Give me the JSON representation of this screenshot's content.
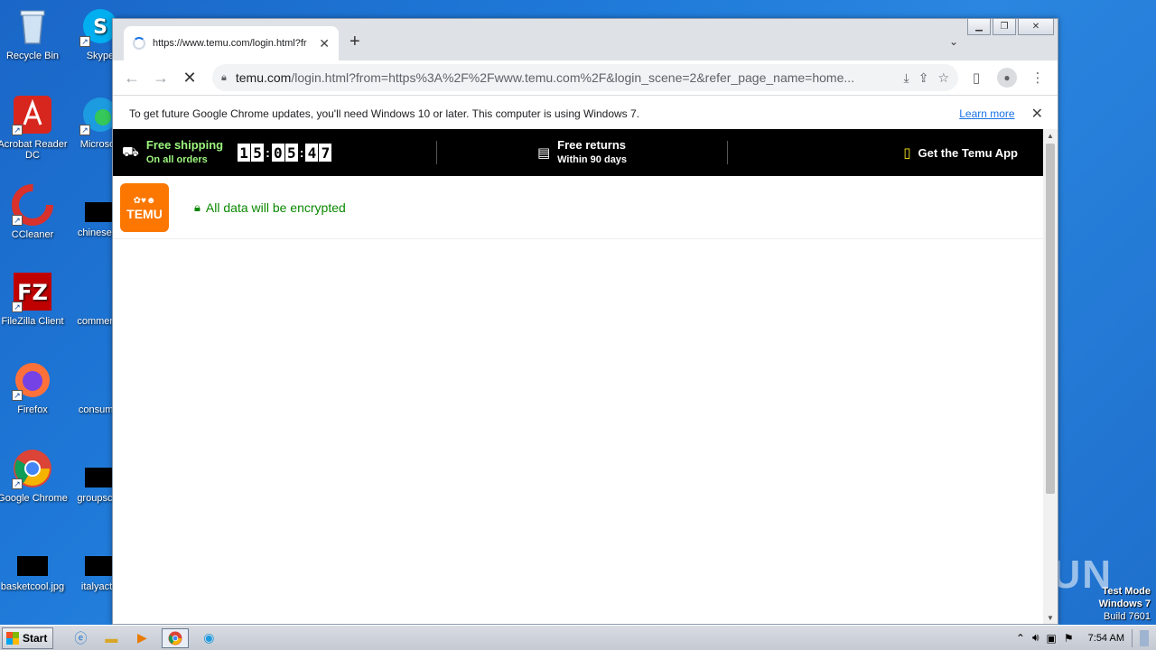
{
  "desktop": {
    "icons_col1": [
      {
        "label": "Recycle Bin",
        "icon": "recycle-bin-icon"
      },
      {
        "label": "Acrobat Reader DC",
        "icon": "acrobat-icon"
      },
      {
        "label": "CCleaner",
        "icon": "ccleaner-icon"
      },
      {
        "label": "FileZilla Client",
        "icon": "filezilla-icon"
      },
      {
        "label": "Firefox",
        "icon": "firefox-icon"
      },
      {
        "label": "Google Chrome",
        "icon": "chrome-icon"
      },
      {
        "label": "basketcool.jpg",
        "icon": "image-file-icon"
      }
    ],
    "icons_col2": [
      {
        "label": "Skype",
        "icon": "skype-icon"
      },
      {
        "label": "Microsoft",
        "icon": "edge-icon"
      },
      {
        "label": "chineseun",
        "icon": "file-icon"
      },
      {
        "label": "commerce",
        "icon": "file-icon"
      },
      {
        "label": "consumer",
        "icon": "file-icon"
      },
      {
        "label": "groupscon",
        "icon": "file-icon"
      },
      {
        "label": "italyactiv",
        "icon": "file-icon"
      }
    ],
    "watermark": "ANY RUN",
    "test_mode": {
      "line1": "Test Mode",
      "line2": "Windows 7",
      "line3": "Build 7601"
    }
  },
  "browser": {
    "tab_title": "https://www.temu.com/login.html?fr",
    "new_tab_label": "+",
    "url_host": "temu.com",
    "url_path": "/login.html?from=https%3A%2F%2Fwww.temu.com%2F&login_scene=2&refer_page_name=home...",
    "infobar_message": "To get future Google Chrome updates, you'll need Windows 10 or later. This computer is using Windows 7.",
    "infobar_link": "Learn more"
  },
  "page": {
    "promo": {
      "shipping_title": "Free shipping",
      "shipping_sub": "On all orders",
      "timer": [
        "1",
        "5",
        ":",
        "0",
        "5",
        ":",
        "4",
        "7"
      ],
      "returns_title": "Free returns",
      "returns_sub": "Within 90 days",
      "app_label": "Get the Temu App"
    },
    "logo_text": "TEMU",
    "secure_text": "All data will be encrypted"
  },
  "taskbar": {
    "start_label": "Start",
    "clock": "7:54 AM"
  },
  "colors": {
    "brand_orange": "#fb7701",
    "secure_green": "#0a8800",
    "promo_green": "#9ef77f"
  }
}
